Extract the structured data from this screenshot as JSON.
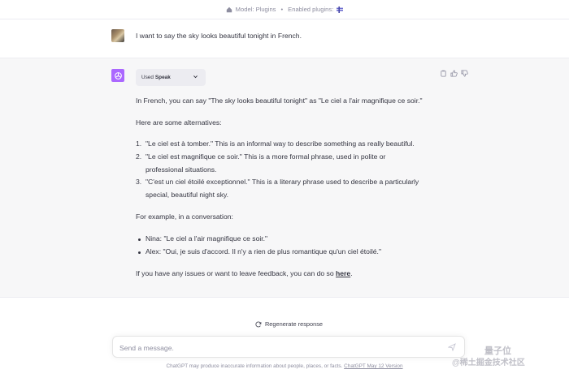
{
  "topbar": {
    "model_label": "Model: Plugins",
    "separator": "•",
    "plugins_label": "Enabled plugins:"
  },
  "user_message": {
    "text": "I want to say the sky looks beautiful tonight in French."
  },
  "assistant": {
    "used_plugin": {
      "prefix": "Used",
      "name": "Speak"
    },
    "intro": "In French, you can say \"The sky looks beautiful tonight\" as \"Le ciel a l'air magnifique ce soir.\"",
    "alternatives_heading": "Here are some alternatives:",
    "alternatives": [
      {
        "num": "1.",
        "line1": "\"Le ciel est à tomber.\" This is an informal way to describe something as really beautiful.",
        "line2": ""
      },
      {
        "num": "2.",
        "line1": "\"Le ciel est magnifique ce soir.\" This is a more formal phrase, used in polite or",
        "line2": "professional situations."
      },
      {
        "num": "3.",
        "line1": "\"C'est un ciel étoilé exceptionnel.\" This is a literary phrase used to describe a particularly",
        "line2": "special, beautiful night sky."
      }
    ],
    "example_heading": "For example, in a conversation:",
    "conversation": [
      "Nina: \"Le ciel a l'air magnifique ce soir.\"",
      "Alex: \"Oui, je suis d'accord. Il n'y a rien de plus romantique qu'un ciel étoilé.\""
    ],
    "feedback_prefix": "If you have any issues or want to leave feedback, you can do so ",
    "feedback_link": "here",
    "feedback_suffix": "."
  },
  "regenerate_label": "Regenerate response",
  "composer": {
    "placeholder": "Send a message."
  },
  "footer": {
    "text": "ChatGPT may produce inaccurate information about people, places, or facts. ",
    "link": "ChatGPT May 12 Version"
  },
  "watermark": {
    "line1": "量子位",
    "line2": "@稀土掘金技术社区"
  },
  "colors": {
    "bot_avatar": "#ab68ff",
    "bot_bg": "#f7f7f8",
    "text": "#343541",
    "muted": "#8e8ea0"
  },
  "icons": [
    "model-icon",
    "plugin-icon",
    "openai-logo-icon",
    "chevron-down-icon",
    "copy-icon",
    "thumbs-up-icon",
    "thumbs-down-icon",
    "refresh-icon",
    "send-icon"
  ]
}
